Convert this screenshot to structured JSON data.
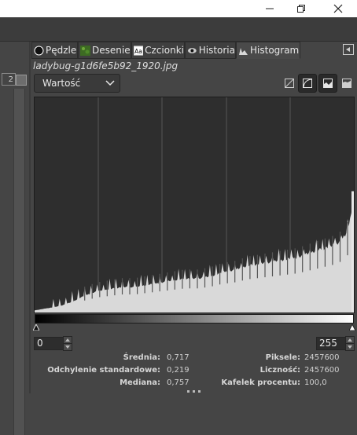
{
  "window": {
    "minimize_icon": "minimize-icon",
    "maximize_icon": "restore-icon",
    "close_icon": "close-icon"
  },
  "left_panel": {
    "zoom_value": "2"
  },
  "tabs": [
    {
      "label": "Pędzle",
      "icon": "brush-icon"
    },
    {
      "label": "Desenie",
      "icon": "pattern-icon"
    },
    {
      "label": "Czcionki",
      "icon": "font-icon"
    },
    {
      "label": "Historia",
      "icon": "history-icon"
    },
    {
      "label": "Histogram",
      "icon": "histogram-icon",
      "active": true
    }
  ],
  "image_name": "ladybug-g1d6fe5b92_1920.jpg",
  "channel": {
    "selected": "Wartość"
  },
  "histogram_modes": [
    "linear-mode-icon",
    "logarithmic-mode-icon",
    "linear-histogram-icon",
    "logarithmic-histogram-icon"
  ],
  "range": {
    "start": "0",
    "end": "255"
  },
  "stats": {
    "mean_label": "Średnia:",
    "mean_value": "0,717",
    "stddev_label": "Odchylenie standardowe:",
    "stddev_value": "0,219",
    "median_label": "Mediana:",
    "median_value": "0,757",
    "pixels_label": "Piksele:",
    "pixels_value": "2457600",
    "count_label": "Liczność:",
    "count_value": "2457600",
    "percentile_label": "Kafelek procentu:",
    "percentile_value": "100,0"
  },
  "chart_data": {
    "type": "area",
    "x_range": [
      0,
      255
    ],
    "y_range": [
      0,
      1
    ],
    "grid": "vertical lines at quarter intervals",
    "x": [
      0,
      10,
      20,
      30,
      40,
      50,
      60,
      70,
      80,
      90,
      100,
      110,
      120,
      130,
      140,
      150,
      160,
      170,
      180,
      190,
      200,
      210,
      220,
      230,
      240,
      245,
      250,
      252,
      254,
      255
    ],
    "values": [
      0.01,
      0.02,
      0.03,
      0.05,
      0.08,
      0.1,
      0.11,
      0.12,
      0.12,
      0.13,
      0.14,
      0.15,
      0.16,
      0.16,
      0.17,
      0.19,
      0.2,
      0.22,
      0.23,
      0.24,
      0.25,
      0.26,
      0.28,
      0.3,
      0.32,
      0.34,
      0.38,
      0.44,
      0.52,
      0.53
    ]
  }
}
